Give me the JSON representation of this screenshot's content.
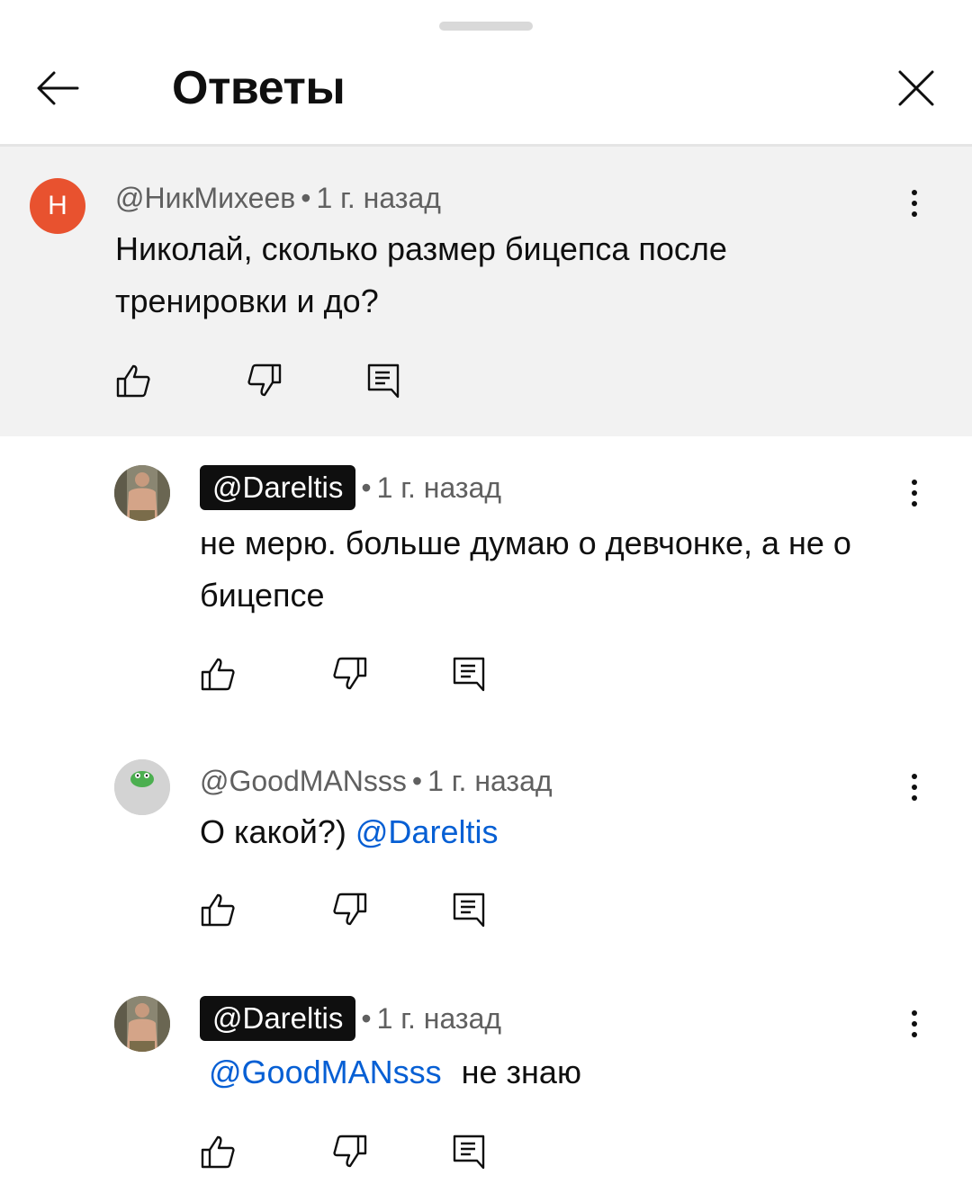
{
  "header": {
    "title": "Ответы"
  },
  "parent_comment": {
    "avatar_letter": "Н",
    "author": "@НикМихеев",
    "separator": "•",
    "time": "1 г. назад",
    "text": "Николай, сколько размер бицепса после тренировки и до?"
  },
  "replies": [
    {
      "author": "@Dareltis",
      "separator": "•",
      "time": "1 г. назад",
      "text": "не мерю. больше думаю о девчонке, а не о бицепсе"
    },
    {
      "author": "@GoodMANsss",
      "separator": "•",
      "time": "1 г. назад",
      "text": "О какой?)",
      "mention": "@Dareltis"
    },
    {
      "author": "@Dareltis",
      "separator": "•",
      "time": "1 г. назад",
      "mention": "@GoodMANsss",
      "text": "не знаю"
    }
  ],
  "colors": {
    "accent_link": "#065fd4",
    "avatar_letter_bg": "#e8522f",
    "parent_bg": "#f2f2f2"
  },
  "icons": {
    "back": "arrow-left-icon",
    "close": "close-icon",
    "more": "more-vert-icon",
    "like": "thumb-up-icon",
    "dislike": "thumb-down-icon",
    "reply": "comment-icon"
  }
}
